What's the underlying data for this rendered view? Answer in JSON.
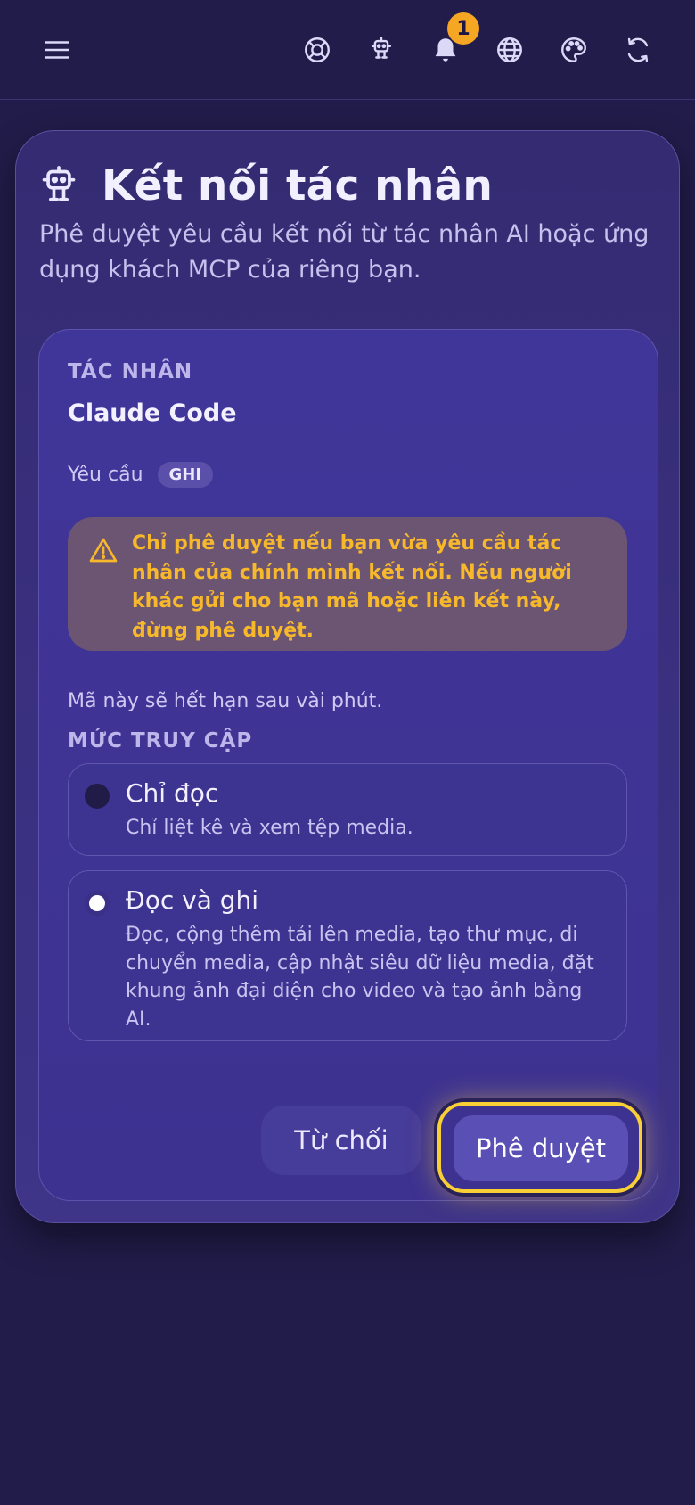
{
  "topbar": {
    "notification_count": "1",
    "icons": [
      "menu-icon",
      "help-lifebuoy-icon",
      "robot-icon",
      "bell-icon",
      "globe-icon",
      "palette-icon",
      "refresh-icon"
    ]
  },
  "card": {
    "title": "Kết nối tác nhân",
    "subtitle": "Phê duyệt yêu cầu kết nối từ tác nhân AI hoặc ứng dụng khách MCP của riêng bạn."
  },
  "agent": {
    "section_label": "TÁC NHÂN",
    "name": "Claude Code",
    "request_label": "Yêu cầu",
    "request_scope": "GHI"
  },
  "warning": {
    "text": "Chỉ phê duyệt nếu bạn vừa yêu cầu tác nhân của chính mình kết nối. Nếu người khác gửi cho bạn mã hoặc liên kết này, đừng phê duyệt.",
    "color": "#f7b82b"
  },
  "expiry_note": "Mã này sẽ hết hạn sau vài phút.",
  "access": {
    "section_label": "MỨC TRUY CẬP",
    "options": [
      {
        "title": "Chỉ đọc",
        "description": "Chỉ liệt kê và xem tệp media.",
        "selected": false
      },
      {
        "title": "Đọc và ghi",
        "description": "Đọc, cộng thêm tải lên media, tạo thư mục, di chuyển media, cập nhật siêu dữ liệu media, đặt khung ảnh đại diện cho video và tạo ảnh bằng AI.",
        "selected": true
      }
    ]
  },
  "actions": {
    "deny_label": "Từ chối",
    "approve_label": "Phê duyệt",
    "focus_color": "#f8cf34"
  }
}
